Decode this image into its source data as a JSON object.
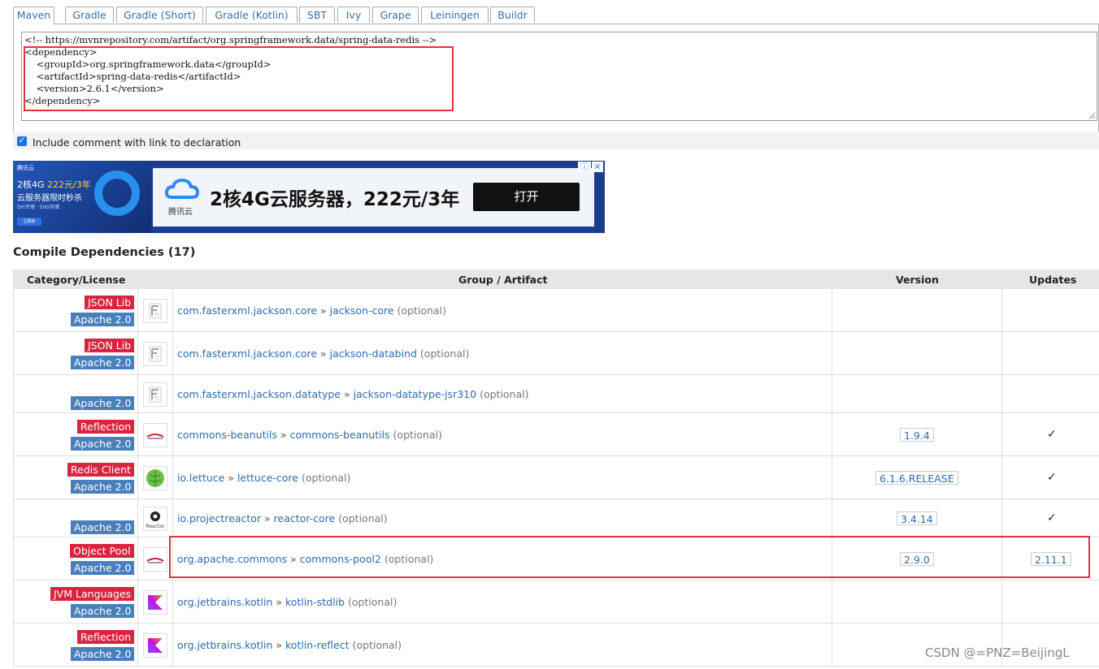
{
  "tabs": [
    "Maven",
    "Gradle",
    "Gradle (Short)",
    "Gradle (Kotlin)",
    "SBT",
    "Ivy",
    "Grape",
    "Leiningen",
    "Buildr"
  ],
  "code_lines": [
    "<!-- https://mvnrepository.com/artifact/org.springframework.data/spring-data-redis -->",
    "<dependency>",
    "    <groupId>org.springframework.data</groupId>",
    "    <artifactId>spring-data-redis</artifactId>",
    "    <version>2.6.1</version>",
    "</dependency>"
  ],
  "include_comment": {
    "checked": true,
    "label": "Include comment with link to declaration"
  },
  "ad": {
    "brand": "腾讯云",
    "left_line1_a": "2核4G",
    "left_line1_b": "222元/3年",
    "left_line2": "云服务器限时秒杀",
    "left_line3": "DIY评测 · 50G存储",
    "left_button": "立即抢",
    "logo_name": "腾讯云",
    "title": "2核4G云服务器，222元/3年",
    "open_button": "打开",
    "info_icon": "ⓘ",
    "close_icon": "✕"
  },
  "section_title": "Compile Dependencies (17)",
  "table": {
    "headers": {
      "category": "Category/License",
      "artifact": "Group / Artifact",
      "version": "Version",
      "updates": "Updates"
    },
    "rows": [
      {
        "category": "JSON Lib",
        "license": "Apache 2.0",
        "logo": "jackson-logo",
        "group": "com.fasterxml.jackson.core",
        "artifact": "jackson-core",
        "optional": "(optional)",
        "version": "",
        "update": ""
      },
      {
        "category": "JSON Lib",
        "license": "Apache 2.0",
        "logo": "jackson-logo",
        "group": "com.fasterxml.jackson.core",
        "artifact": "jackson-databind",
        "optional": "(optional)",
        "version": "",
        "update": ""
      },
      {
        "category": "",
        "license": "Apache 2.0",
        "logo": "jackson-logo",
        "group": "com.fasterxml.jackson.datatype",
        "artifact": "jackson-datatype-jsr310",
        "optional": "(optional)",
        "version": "",
        "update": ""
      },
      {
        "category": "Reflection",
        "license": "Apache 2.0",
        "logo": "apache-feather-logo",
        "group": "commons-beanutils",
        "artifact": "commons-beanutils",
        "optional": "(optional)",
        "version": "1.9.4",
        "update": "✓"
      },
      {
        "category": "Redis Client",
        "license": "Apache 2.0",
        "logo": "lettuce-logo",
        "group": "io.lettuce",
        "artifact": "lettuce-core",
        "optional": "(optional)",
        "version": "6.1.6.RELEASE",
        "update": "✓"
      },
      {
        "category": "",
        "license": "Apache 2.0",
        "logo": "reactor-logo",
        "group": "io.projectreactor",
        "artifact": "reactor-core",
        "optional": "(optional)",
        "version": "3.4.14",
        "update": "✓"
      },
      {
        "category": "Object Pool",
        "license": "Apache 2.0",
        "logo": "apache-feather-logo",
        "group": "org.apache.commons",
        "artifact": "commons-pool2",
        "optional": "(optional)",
        "version": "2.9.0",
        "update": "2.11.1"
      },
      {
        "category": "JVM Languages",
        "license": "Apache 2.0",
        "logo": "kotlin-logo",
        "group": "org.jetbrains.kotlin",
        "artifact": "kotlin-stdlib",
        "optional": "(optional)",
        "version": "",
        "update": ""
      },
      {
        "category": "Reflection",
        "license": "Apache 2.0",
        "logo": "kotlin-logo",
        "group": "org.jetbrains.kotlin",
        "artifact": "kotlin-reflect",
        "optional": "(optional)",
        "version": "",
        "update": ""
      }
    ]
  },
  "separator": "»",
  "watermark": "CSDN @=PNZ=BeijingL",
  "colors": {
    "category_badge": "#d8243f",
    "license_badge": "#4a7fbe",
    "link": "#2d6bab",
    "highlight": "#d9373b"
  }
}
